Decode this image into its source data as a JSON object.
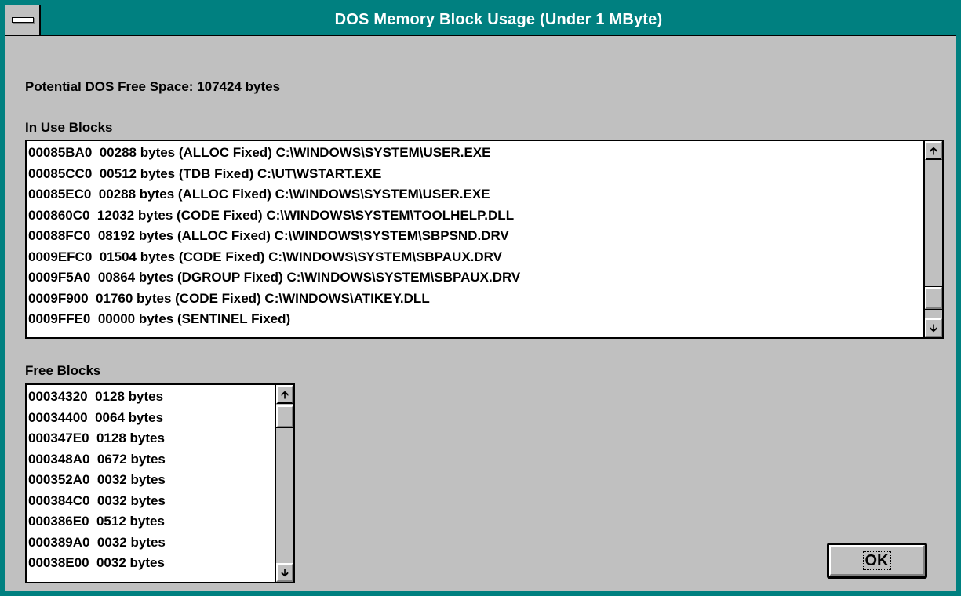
{
  "window": {
    "title": "DOS Memory Block Usage (Under 1 MByte)"
  },
  "summary": {
    "text": "Potential DOS Free Space: 107424 bytes"
  },
  "in_use": {
    "label": "In Use Blocks",
    "rows": [
      "00085BA0  00288 bytes (ALLOC Fixed) C:\\WINDOWS\\SYSTEM\\USER.EXE",
      "00085CC0  00512 bytes (TDB Fixed) C:\\UT\\WSTART.EXE",
      "00085EC0  00288 bytes (ALLOC Fixed) C:\\WINDOWS\\SYSTEM\\USER.EXE",
      "000860C0  12032 bytes (CODE Fixed) C:\\WINDOWS\\SYSTEM\\TOOLHELP.DLL",
      "00088FC0  08192 bytes (ALLOC Fixed) C:\\WINDOWS\\SYSTEM\\SBPSND.DRV",
      "0009EFC0  01504 bytes (CODE Fixed) C:\\WINDOWS\\SYSTEM\\SBPAUX.DRV",
      "0009F5A0  00864 bytes (DGROUP Fixed) C:\\WINDOWS\\SYSTEM\\SBPAUX.DRV",
      "0009F900  01760 bytes (CODE Fixed) C:\\WINDOWS\\ATIKEY.DLL",
      "0009FFE0  00000 bytes (SENTINEL Fixed)"
    ]
  },
  "free": {
    "label": "Free Blocks",
    "rows": [
      "00034320  0128 bytes",
      "00034400  0064 bytes",
      "000347E0  0128 bytes",
      "000348A0  0672 bytes",
      "000352A0  0032 bytes",
      "000384C0  0032 bytes",
      "000386E0  0512 bytes",
      "000389A0  0032 bytes",
      "00038E00  0032 bytes"
    ]
  },
  "buttons": {
    "ok": "OK"
  },
  "icons": {
    "system_menu": "system-menu-icon",
    "scroll_up": "arrow-up-icon",
    "scroll_down": "arrow-down-icon"
  },
  "colors": {
    "titlebar": "#008080",
    "face": "#c0c0c0"
  }
}
